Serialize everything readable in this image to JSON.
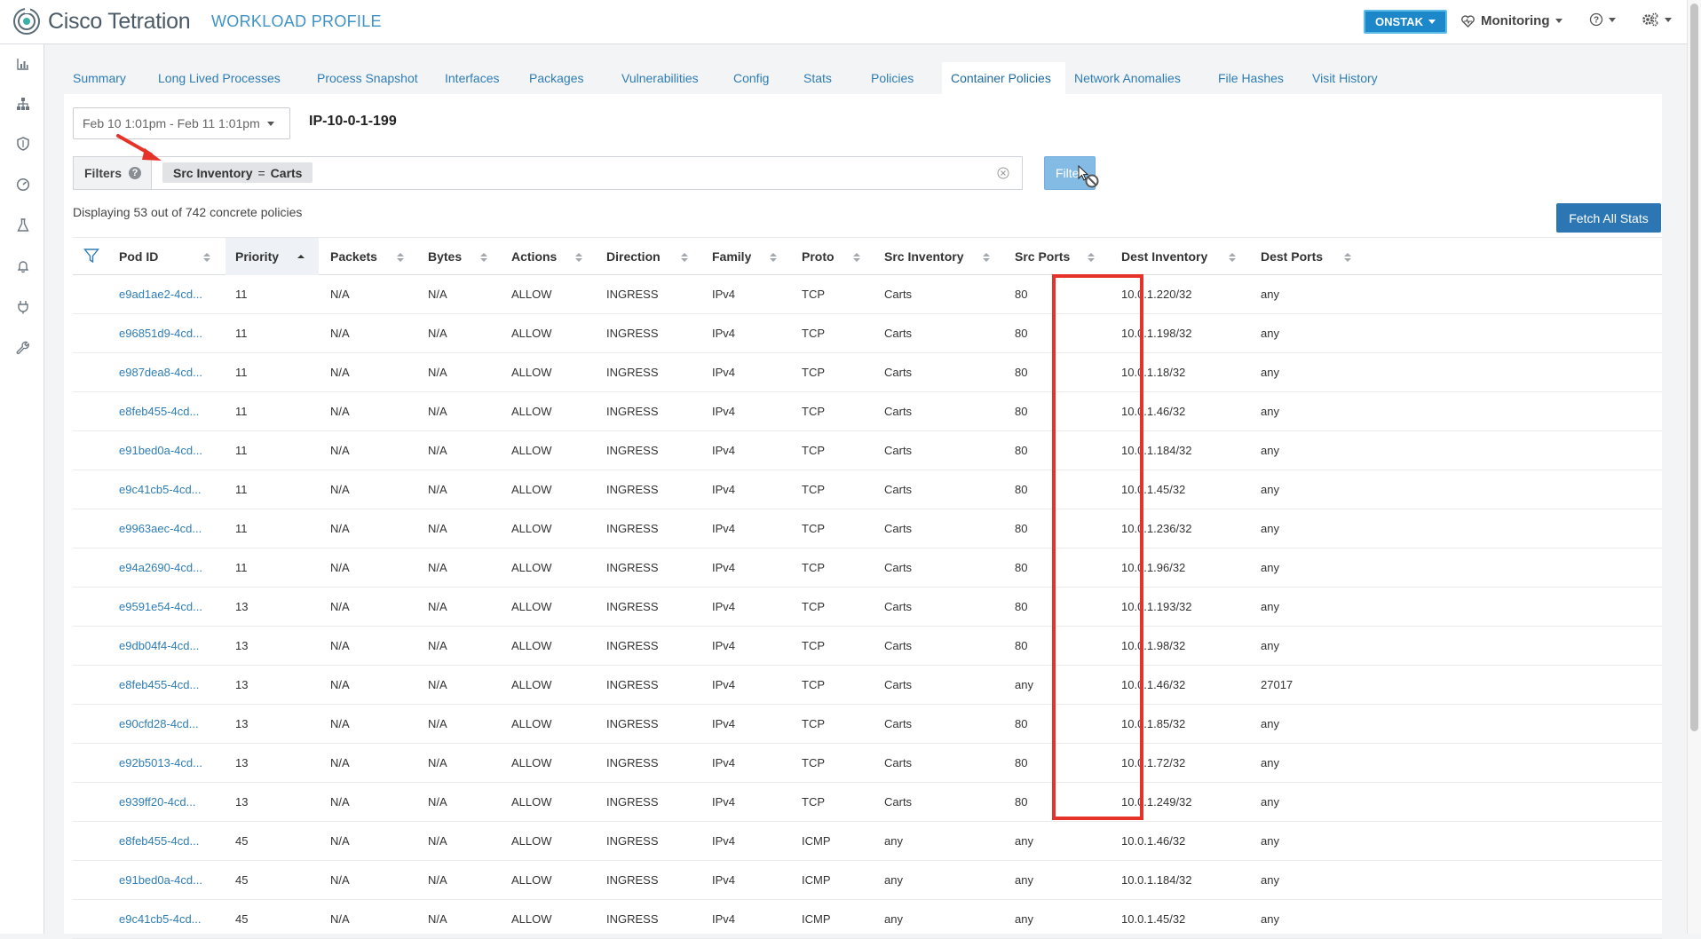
{
  "header": {
    "logo_text": "Cisco Tetration",
    "page_title": "WORKLOAD PROFILE",
    "tenant": "ONSTAK",
    "monitoring": "Monitoring"
  },
  "tabs": [
    {
      "label": "Summary"
    },
    {
      "label": "Long Lived Processes"
    },
    {
      "label": "Process Snapshot"
    },
    {
      "label": "Interfaces"
    },
    {
      "label": "Packages"
    },
    {
      "label": "Vulnerabilities"
    },
    {
      "label": "Config"
    },
    {
      "label": "Stats"
    },
    {
      "label": "Policies"
    },
    {
      "label": "Container Policies",
      "active": true
    },
    {
      "label": "Network Anomalies"
    },
    {
      "label": "File Hashes"
    },
    {
      "label": "Visit History"
    }
  ],
  "toolbar": {
    "date_range": "Feb 10 1:01pm - Feb 11 1:01pm",
    "host": "IP-10-0-1-199"
  },
  "filter": {
    "label": "Filters",
    "help": "?",
    "chip_field": "Src Inventory",
    "chip_op": "=",
    "chip_value": "Carts",
    "button": "Filter"
  },
  "summary": "Displaying 53 out of 742 concrete policies",
  "fetch_button": "Fetch All Stats",
  "columns": [
    "Pod ID",
    "Priority",
    "Packets",
    "Bytes",
    "Actions",
    "Direction",
    "Family",
    "Proto",
    "Src Inventory",
    "Src Ports",
    "Dest Inventory",
    "Dest Ports"
  ],
  "sort": {
    "column": "Priority",
    "direction": "ascending"
  },
  "rows": [
    [
      "e9ad1ae2-4cd...",
      "11",
      "N/A",
      "N/A",
      "ALLOW",
      "INGRESS",
      "IPv4",
      "TCP",
      "Carts",
      "80",
      "10.0.1.220/32",
      "any"
    ],
    [
      "e96851d9-4cd...",
      "11",
      "N/A",
      "N/A",
      "ALLOW",
      "INGRESS",
      "IPv4",
      "TCP",
      "Carts",
      "80",
      "10.0.1.198/32",
      "any"
    ],
    [
      "e987dea8-4cd...",
      "11",
      "N/A",
      "N/A",
      "ALLOW",
      "INGRESS",
      "IPv4",
      "TCP",
      "Carts",
      "80",
      "10.0.1.18/32",
      "any"
    ],
    [
      "e8feb455-4cd...",
      "11",
      "N/A",
      "N/A",
      "ALLOW",
      "INGRESS",
      "IPv4",
      "TCP",
      "Carts",
      "80",
      "10.0.1.46/32",
      "any"
    ],
    [
      "e91bed0a-4cd...",
      "11",
      "N/A",
      "N/A",
      "ALLOW",
      "INGRESS",
      "IPv4",
      "TCP",
      "Carts",
      "80",
      "10.0.1.184/32",
      "any"
    ],
    [
      "e9c41cb5-4cd...",
      "11",
      "N/A",
      "N/A",
      "ALLOW",
      "INGRESS",
      "IPv4",
      "TCP",
      "Carts",
      "80",
      "10.0.1.45/32",
      "any"
    ],
    [
      "e9963aec-4cd...",
      "11",
      "N/A",
      "N/A",
      "ALLOW",
      "INGRESS",
      "IPv4",
      "TCP",
      "Carts",
      "80",
      "10.0.1.236/32",
      "any"
    ],
    [
      "e94a2690-4cd...",
      "11",
      "N/A",
      "N/A",
      "ALLOW",
      "INGRESS",
      "IPv4",
      "TCP",
      "Carts",
      "80",
      "10.0.1.96/32",
      "any"
    ],
    [
      "e9591e54-4cd...",
      "13",
      "N/A",
      "N/A",
      "ALLOW",
      "INGRESS",
      "IPv4",
      "TCP",
      "Carts",
      "80",
      "10.0.1.193/32",
      "any"
    ],
    [
      "e9db04f4-4cd...",
      "13",
      "N/A",
      "N/A",
      "ALLOW",
      "INGRESS",
      "IPv4",
      "TCP",
      "Carts",
      "80",
      "10.0.1.98/32",
      "any"
    ],
    [
      "e8feb455-4cd...",
      "13",
      "N/A",
      "N/A",
      "ALLOW",
      "INGRESS",
      "IPv4",
      "TCP",
      "Carts",
      "any",
      "10.0.1.46/32",
      "27017"
    ],
    [
      "e90cfd28-4cd...",
      "13",
      "N/A",
      "N/A",
      "ALLOW",
      "INGRESS",
      "IPv4",
      "TCP",
      "Carts",
      "80",
      "10.0.1.85/32",
      "any"
    ],
    [
      "e92b5013-4cd...",
      "13",
      "N/A",
      "N/A",
      "ALLOW",
      "INGRESS",
      "IPv4",
      "TCP",
      "Carts",
      "80",
      "10.0.1.72/32",
      "any"
    ],
    [
      "e939ff20-4cd...",
      "13",
      "N/A",
      "N/A",
      "ALLOW",
      "INGRESS",
      "IPv4",
      "TCP",
      "Carts",
      "80",
      "10.0.1.249/32",
      "any"
    ],
    [
      "e8feb455-4cd...",
      "45",
      "N/A",
      "N/A",
      "ALLOW",
      "INGRESS",
      "IPv4",
      "ICMP",
      "any",
      "any",
      "10.0.1.46/32",
      "any"
    ],
    [
      "e91bed0a-4cd...",
      "45",
      "N/A",
      "N/A",
      "ALLOW",
      "INGRESS",
      "IPv4",
      "ICMP",
      "any",
      "any",
      "10.0.1.184/32",
      "any"
    ],
    [
      "e9c41cb5-4cd...",
      "45",
      "N/A",
      "N/A",
      "ALLOW",
      "INGRESS",
      "IPv4",
      "ICMP",
      "any",
      "any",
      "10.0.1.45/32",
      "any"
    ]
  ],
  "colors": {
    "link": "#2e7db5",
    "accent": "#1c87c9",
    "highlight": "#e5332a"
  },
  "icons": {
    "sidebar": [
      "bar-chart-icon",
      "hierarchy-icon",
      "shield-icon",
      "dashboard-icon",
      "flask-icon",
      "bell-icon",
      "plug-icon",
      "wrench-icon"
    ],
    "header": [
      "heart-monitor-icon",
      "help-icon",
      "settings-icon"
    ]
  }
}
